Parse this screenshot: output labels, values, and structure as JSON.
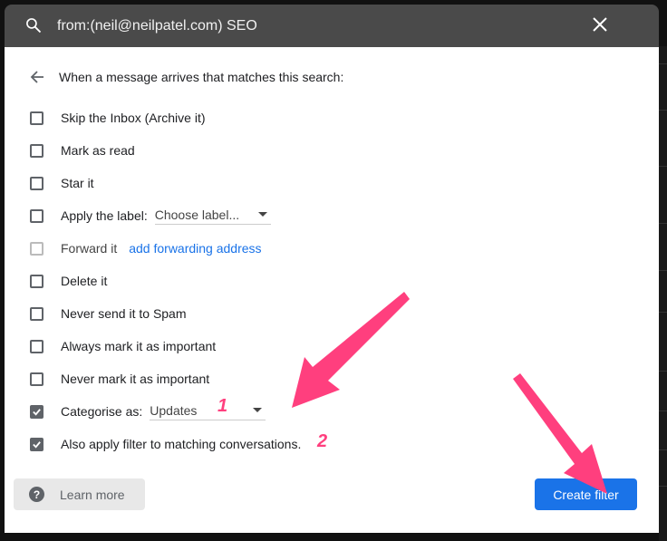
{
  "search": {
    "query": "from:(neil@neilpatel.com) SEO"
  },
  "header": {
    "text": "When a message arrives that matches this search:"
  },
  "options": [
    {
      "label": "Skip the Inbox (Archive it)",
      "checked": false
    },
    {
      "label": "Mark as read",
      "checked": false
    },
    {
      "label": "Star it",
      "checked": false
    },
    {
      "label": "Apply the label:",
      "checked": false,
      "select": "Choose label..."
    },
    {
      "label": "Forward it",
      "checked": false,
      "disabled": true,
      "link": "add forwarding address"
    },
    {
      "label": "Delete it",
      "checked": false
    },
    {
      "label": "Never send it to Spam",
      "checked": false
    },
    {
      "label": "Always mark it as important",
      "checked": false
    },
    {
      "label": "Never mark it as important",
      "checked": false
    },
    {
      "label": "Categorise as:",
      "checked": true,
      "select": "Updates"
    },
    {
      "label": "Also apply filter to matching conversations.",
      "checked": true
    }
  ],
  "buttons": {
    "learn_more": "Learn more",
    "create_filter": "Create filter"
  },
  "annotations": {
    "step1": "1",
    "step2": "2",
    "color": "#ff3f7e"
  },
  "colors": {
    "primary": "#1a73e8"
  }
}
